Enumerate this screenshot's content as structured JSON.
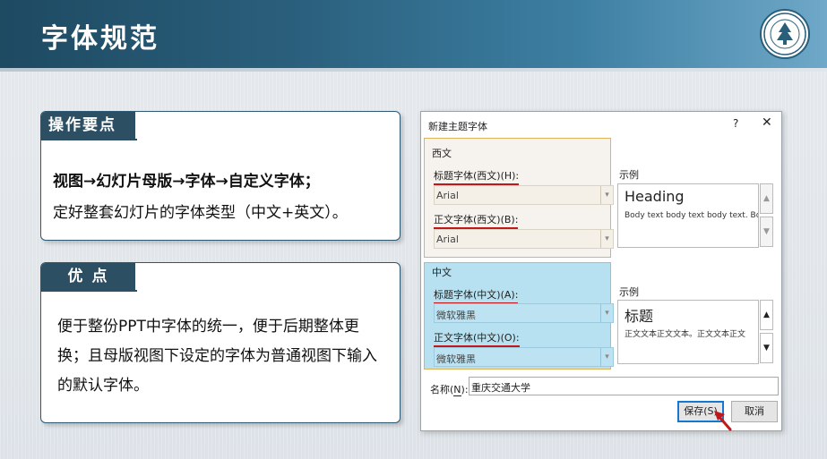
{
  "page": {
    "title": "字体规范"
  },
  "ops_card": {
    "tag": "操作要点",
    "line1": "视图→幻灯片母版→字体→自定义字体；",
    "line2": "定好整套幻灯片的字体类型（中文+英文）。"
  },
  "adv_card": {
    "tag": "优 点",
    "text": "便于整份PPT中字体的统一，便于后期整体更换；且母版视图下设定的字体为普通视图下输入的默认字体。"
  },
  "dialog": {
    "title": "新建主题字体",
    "help": "?",
    "close": "✕",
    "western": {
      "group_label": "西文",
      "heading_label": "标题字体(西文)(H):",
      "heading_value": "Arial",
      "body_label": "正文字体(西文)(B):",
      "body_value": "Arial",
      "sample_label": "示例",
      "sample_heading": "Heading",
      "sample_body": "Body text body text body text. Body t"
    },
    "chinese": {
      "group_label": "中文",
      "heading_label": "标题字体(中文)(A):",
      "heading_value": "微软雅黑",
      "body_label": "正文字体(中文)(O):",
      "body_value": "微软雅黑",
      "sample_label": "示例",
      "sample_heading": "标题",
      "sample_body": "正文文本正文文本。正文文本正文"
    },
    "name_label_prefix": "名称(",
    "name_label_key": "N",
    "name_label_suffix": "):",
    "name_value": "重庆交通大学",
    "save_label": "保存(S)",
    "cancel_label": "取消"
  },
  "colors": {
    "title_bar": "#2a5f7c",
    "card_tag": "#2d4f64",
    "underline": "#c0181b",
    "highlight_border": "#e0b25a",
    "chinese_bg": "#b7e1f0",
    "save_focus": "#1677d1"
  }
}
